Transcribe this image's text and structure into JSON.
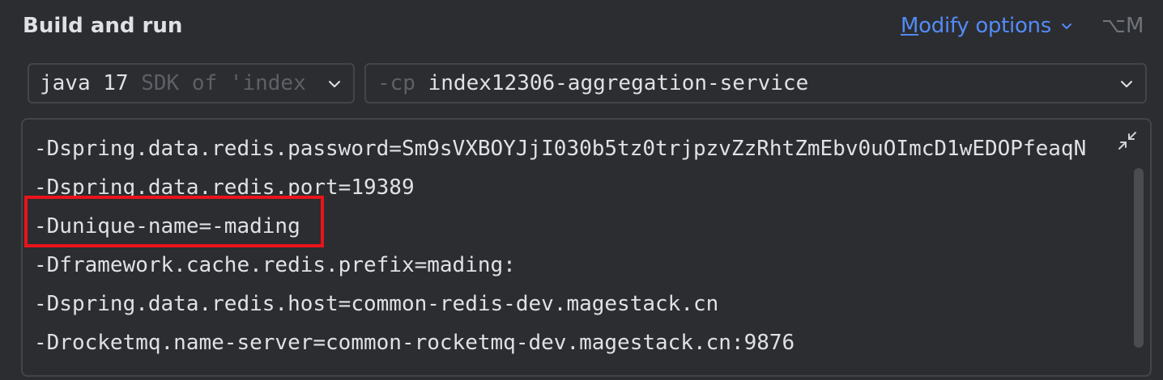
{
  "section": {
    "title": "Build and run"
  },
  "modify_options": {
    "mnemonic": "M",
    "rest": "odify options",
    "shortcut": "⌥M"
  },
  "jre_combo": {
    "value": "java 17",
    "hint": " SDK of 'index"
  },
  "classpath_combo": {
    "prefix": "-cp ",
    "value": "index12306-aggregation-service"
  },
  "vm_options": {
    "lines": [
      "-Dspring.data.redis.password=Sm9sVXBOYJjI030b5tz0trjpzvZzRhtZmEbv0uOImcD1wEDOPfeaqN",
      "-Dspring.data.redis.port=19389",
      "-Dunique-name=-mading",
      "-Dframework.cache.redis.prefix=mading:",
      "-Dspring.data.redis.host=common-redis-dev.magestack.cn",
      "-Drocketmq.name-server=common-rocketmq-dev.magestack.cn:9876"
    ],
    "highlighted_line_index": 2
  },
  "colors": {
    "background": "#2b2d30",
    "accent_link": "#548af7",
    "highlight": "#e8141a",
    "text": "#dfe1e5",
    "hint": "#5d6066"
  },
  "icons": {
    "modify_chevron": "chevron-down-icon",
    "combo_chevron": "chevron-down-icon",
    "collapse": "collapse-arrows-icon"
  }
}
